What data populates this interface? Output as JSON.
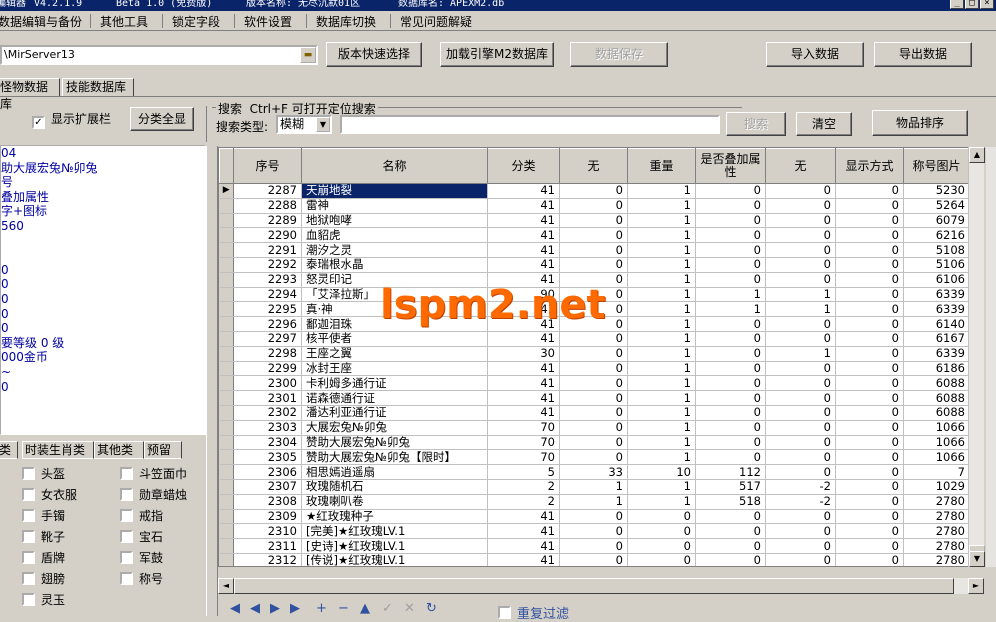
{
  "title": {
    "app": "编辑器",
    "version": "V4.2.1.9",
    "edition": "Beta 1.0 (免费版)",
    "version_name": "版本名称: 无尽沉默01区",
    "db_name": "数据库名: APEXM2.db"
  },
  "menu": [
    "数据编辑与备份",
    "其他工具",
    "锁定字段",
    "软件设置",
    "数据库切换",
    "常见问题解疑"
  ],
  "toolbar": {
    "path": "\\MirServer13",
    "btn_version_select": "版本快速选择",
    "btn_load_engine": "加载引擎M2数据库",
    "btn_save": "数据保存",
    "btn_import": "导入数据",
    "btn_export": "导出数据"
  },
  "db_tabs": [
    "怪物数据库",
    "技能数据库"
  ],
  "left": {
    "show_ext_label": "显示扩展栏",
    "btn_select_all": "分类全显",
    "info_lines": [
      "04",
      "助大展宏兔№卯兔",
      "号",
      "叠加属性",
      "字+图标",
      "560",
      "",
      "",
      "0",
      "0",
      "0",
      "0",
      "0",
      "要等级 0 级",
      "000金币",
      "~",
      "0"
    ],
    "cat_tabs": [
      "类",
      "时装生肖类",
      "其他类",
      "预留"
    ],
    "checkboxes": [
      "头盔",
      "斗笠面巾",
      "女衣服",
      "勋章蜡烛",
      "手镯",
      "戒指",
      "靴子",
      "宝石",
      "盾牌",
      "军鼓",
      "翅膀",
      "称号",
      "灵玉"
    ]
  },
  "search": {
    "group_label": "搜索  Ctrl+F 可打开定位搜索",
    "type_label": "搜索类型:",
    "type_value": "模糊",
    "input_value": "",
    "btn_search": "搜索",
    "btn_clear": "清空",
    "btn_sort": "物品排序"
  },
  "grid": {
    "columns": [
      "序号",
      "名称",
      "分类",
      "无",
      "重量",
      "是否叠加属性",
      "无",
      "显示方式",
      "称号图片"
    ],
    "rows": [
      [
        "2287",
        "天崩地裂",
        "41",
        "0",
        "1",
        "0",
        "0",
        "0",
        "5230"
      ],
      [
        "2288",
        "雷神",
        "41",
        "0",
        "1",
        "0",
        "0",
        "0",
        "5264"
      ],
      [
        "2289",
        "地狱咆哮",
        "41",
        "0",
        "1",
        "0",
        "0",
        "0",
        "6079"
      ],
      [
        "2290",
        "血貂虎",
        "41",
        "0",
        "1",
        "0",
        "0",
        "0",
        "6216"
      ],
      [
        "2291",
        "潮汐之灵",
        "41",
        "0",
        "1",
        "0",
        "0",
        "0",
        "5108"
      ],
      [
        "2292",
        "泰瑞根水晶",
        "41",
        "0",
        "1",
        "0",
        "0",
        "0",
        "5106"
      ],
      [
        "2293",
        "怒灵印记",
        "41",
        "0",
        "1",
        "0",
        "0",
        "0",
        "6106"
      ],
      [
        "2294",
        "「艾泽拉斯」",
        "90",
        "0",
        "1",
        "1",
        "1",
        "0",
        "6339"
      ],
      [
        "2295",
        "真·神",
        "41",
        "0",
        "1",
        "1",
        "1",
        "0",
        "6339"
      ],
      [
        "2296",
        "鄱迦泪珠",
        "41",
        "0",
        "1",
        "0",
        "0",
        "0",
        "6140"
      ],
      [
        "2297",
        "核平使者",
        "41",
        "0",
        "1",
        "0",
        "0",
        "0",
        "6167"
      ],
      [
        "2298",
        "王座之翼",
        "30",
        "0",
        "1",
        "0",
        "1",
        "0",
        "6339"
      ],
      [
        "2299",
        "冰封王座",
        "41",
        "0",
        "1",
        "0",
        "0",
        "0",
        "6186"
      ],
      [
        "2300",
        "卡利姆多通行证",
        "41",
        "0",
        "1",
        "0",
        "0",
        "0",
        "6088"
      ],
      [
        "2301",
        "诺森德通行证",
        "41",
        "0",
        "1",
        "0",
        "0",
        "0",
        "6088"
      ],
      [
        "2302",
        "潘达利亚通行证",
        "41",
        "0",
        "1",
        "0",
        "0",
        "0",
        "6088"
      ],
      [
        "2303",
        "大展宏兔№卯兔",
        "70",
        "0",
        "1",
        "0",
        "0",
        "0",
        "1066"
      ],
      [
        "2304",
        "赞助大展宏兔№卯兔",
        "70",
        "0",
        "1",
        "0",
        "0",
        "0",
        "1066"
      ],
      [
        "2305",
        "赞助大展宏兔№卯兔【限时】",
        "70",
        "0",
        "1",
        "0",
        "0",
        "0",
        "1066"
      ],
      [
        "2306",
        "相思嫣逍遥扇",
        "5",
        "33",
        "10",
        "112",
        "0",
        "0",
        "7"
      ],
      [
        "2307",
        "玫瑰随机石",
        "2",
        "1",
        "1",
        "517",
        "-2",
        "0",
        "1029"
      ],
      [
        "2308",
        "玫瑰喇叭卷",
        "2",
        "1",
        "1",
        "518",
        "-2",
        "0",
        "2780"
      ],
      [
        "2309",
        "★红玫瑰种子",
        "41",
        "0",
        "0",
        "0",
        "0",
        "0",
        "2780"
      ],
      [
        "2310",
        "[完美]★红玫瑰LV.1",
        "41",
        "0",
        "0",
        "0",
        "0",
        "0",
        "2780"
      ],
      [
        "2311",
        "[史诗]★红玫瑰LV.1",
        "41",
        "0",
        "0",
        "0",
        "0",
        "0",
        "2780"
      ],
      [
        "2312",
        "[传说]★红玫瑰LV.1",
        "41",
        "0",
        "0",
        "0",
        "0",
        "0",
        "2780"
      ]
    ]
  },
  "footer": {
    "filter_label": "重复过滤"
  },
  "watermark": "lspm2.net",
  "colors": {
    "titlebar": "#0a246a",
    "selection": "#0a246a",
    "watermark": "#ff6a00",
    "info_text": "#0000a0"
  }
}
